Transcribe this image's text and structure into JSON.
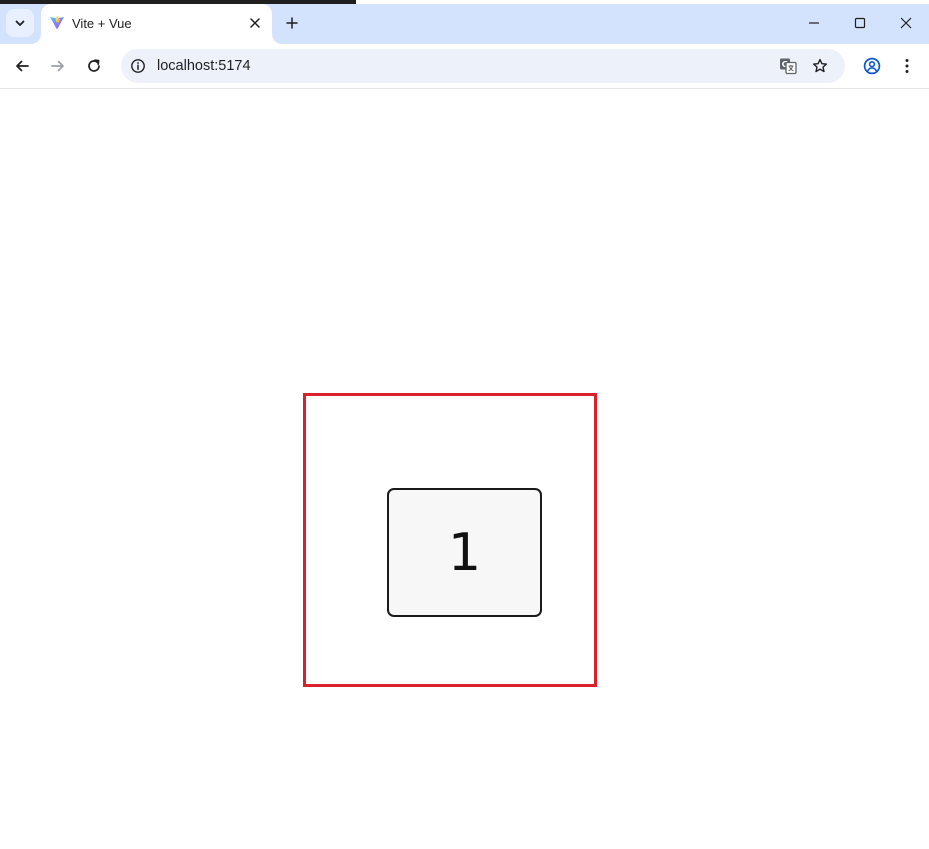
{
  "browser": {
    "tab": {
      "title": "Vite + Vue",
      "favicon": "vite-logo-icon"
    },
    "address_bar": {
      "url": "localhost:5174"
    },
    "icons": {
      "tab_search": "chevron-down-icon",
      "tab_close": "close-icon",
      "new_tab": "plus-icon",
      "minimize": "minimize-icon",
      "maximize": "maximize-icon",
      "window_close": "close-icon",
      "back": "arrow-left-icon",
      "forward": "arrow-right-icon",
      "reload": "reload-icon",
      "site_info": "info-icon",
      "translate": "translate-icon",
      "bookmark": "star-icon",
      "profile": "profile-icon",
      "menu": "kebab-menu-icon"
    },
    "colors": {
      "tabstrip_bg": "#d3e3fd",
      "omnibox_bg": "#edf2fa"
    }
  },
  "page": {
    "card": {
      "number": "1"
    },
    "colors": {
      "frame_border": "#d8232a",
      "card_bg": "#f7f7f7",
      "card_border": "#1a1a1a"
    }
  }
}
